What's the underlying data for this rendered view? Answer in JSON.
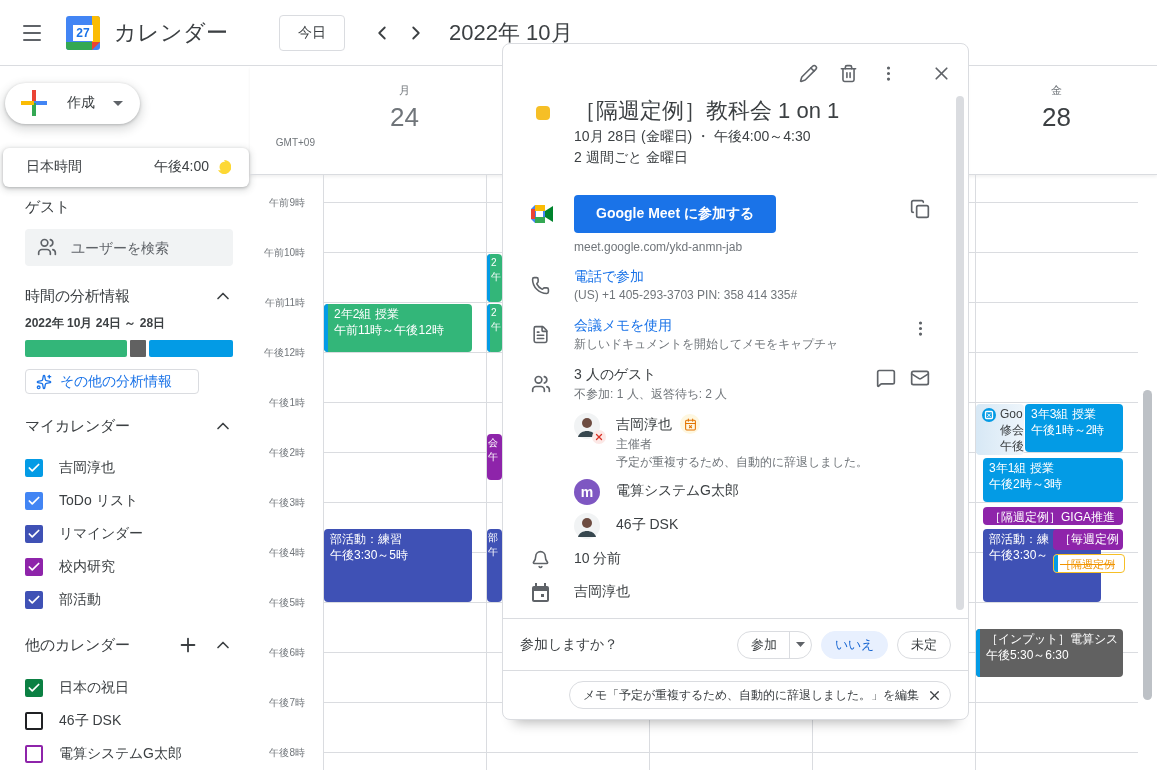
{
  "header": {
    "logo_text": "27",
    "app_name": "カレンダー",
    "today_button": "今日",
    "period": "2022年 10月"
  },
  "create_button": "作成",
  "timezone": {
    "label": "日本時間",
    "time": "午後4:00"
  },
  "guests_section": {
    "title": "ゲスト",
    "search_placeholder": "ユーザーを検索"
  },
  "time_insights": {
    "title": "時間の分析情報",
    "expanded": true,
    "range": "2022年 10月 24日 ～ 28日",
    "more_button": "その他の分析情報"
  },
  "my_calendars": {
    "title": "マイカレンダー",
    "expanded": true,
    "items": [
      {
        "name": "吉岡淳也",
        "checked": true,
        "color": "#039be5"
      },
      {
        "name": "ToDo リスト",
        "checked": true,
        "color": "#4285f4"
      },
      {
        "name": "リマインダー",
        "checked": true,
        "color": "#3f51b5"
      },
      {
        "name": "校内研究",
        "checked": true,
        "color": "#8e24aa"
      },
      {
        "name": "部活動",
        "checked": true,
        "color": "#3f51b5"
      }
    ]
  },
  "other_calendars": {
    "title": "他のカレンダー",
    "expanded": true,
    "items": [
      {
        "name": "日本の祝日",
        "checked": true,
        "color": "#0b8043"
      },
      {
        "name": "46子 DSK",
        "checked": false,
        "color": "#202124"
      },
      {
        "name": "電算システムG太郎",
        "checked": false,
        "color": "#8e24aa"
      }
    ]
  },
  "week": {
    "timezone_label": "GMT+09",
    "hours": [
      "午前9時",
      "午前10時",
      "午前11時",
      "午後12時",
      "午後1時",
      "午後2時",
      "午後3時",
      "午後4時",
      "午後5時",
      "午後6時",
      "午後7時",
      "午後8時"
    ],
    "day_columns": [
      {
        "weekday": "月",
        "date": "24",
        "events": [
          {
            "kind": "solid",
            "lines": [
              "2年2組 授業",
              "午前11時～午後12時"
            ],
            "color": "#33b679",
            "stripe": {
              "color": "#039be5"
            }
          },
          {
            "kind": "solid",
            "lines": [
              "部活動：練習",
              "午後3:30～5時"
            ],
            "color": "#3f51b5"
          }
        ]
      },
      {
        "events": [
          {
            "kind": "solid",
            "lines": [
              "2",
              "午"
            ],
            "color": "#33b679",
            "stripe": {
              "color": "#039be5"
            }
          },
          {
            "kind": "solid",
            "lines": [
              "2",
              "午"
            ],
            "color": "#33b679",
            "stripe": {
              "color": "#039be5"
            }
          },
          {
            "kind": "solid",
            "lines": [
              "会",
              "午"
            ],
            "color": "#8e24aa"
          },
          {
            "kind": "solid",
            "lines": [
              "部",
              "午"
            ],
            "color": "#3f51b5"
          }
        ]
      },
      {},
      {},
      {
        "weekday": "金",
        "date": "28",
        "events": [
          {
            "kind": "outlined",
            "lines": [
              "Goo",
              "修会",
              "午後"
            ],
            "color": "#d7e8f5"
          },
          {
            "kind": "solid",
            "lines": [
              "3年3組 授業",
              "午後1時～2時"
            ],
            "color": "#039be5"
          },
          {
            "kind": "solid",
            "lines": [
              "3年1組 授業",
              "午後2時～3時"
            ],
            "color": "#039be5"
          },
          {
            "kind": "solid",
            "lines": [
              "［隔週定例］GIGA推進"
            ],
            "color": "#8e24aa"
          },
          {
            "kind": "solid",
            "lines": [
              "部活動：練",
              "午後3:30～"
            ],
            "color": "#3f51b5"
          },
          {
            "kind": "solid",
            "lines": [
              "［毎週定例"
            ],
            "color": "#8e24aa"
          },
          {
            "kind": "declined",
            "lines": [
              "［隔週定例"
            ],
            "color": "#f6bf26",
            "stripe": {
              "color": "#039be5"
            }
          },
          {
            "kind": "solid",
            "lines": [
              "［インプット］電算シス",
              "午後5:30～6:30"
            ],
            "color": "#616161",
            "stripe": {
              "color": "#039be5"
            }
          }
        ]
      }
    ]
  },
  "event_popup": {
    "color": "#f6bf26",
    "title": "［隔週定例］教科会 1 on 1",
    "when": "10月 28日 (金曜日) ・ 午後4:00～4:30",
    "recurrence": "2 週間ごと 金曜日",
    "meet_button": "Google Meet に参加する",
    "meet_link": "meet.google.com/ykd-anmn-jab",
    "phone_link": "電話で参加",
    "phone_detail": "(US) +1 405-293-3703 PIN: 358 414 335#",
    "notes_link": "会議メモを使用",
    "notes_detail": "新しいドキュメントを開始してメモをキャプチャ",
    "guests_title": "3 人のゲスト",
    "guests_summary": "不参加: 1 人、返答待ち: 2 人",
    "guests": [
      {
        "name": "吉岡淳也",
        "kind": "photo",
        "declined": true,
        "organizer": true,
        "role": "主催者",
        "note": "予定が重複するため、自動的に辞退しました。"
      },
      {
        "name": "電算システムG太郎",
        "kind": "letter",
        "letter": "m",
        "declined": false,
        "organizer": false
      },
      {
        "name": "46子 DSK",
        "kind": "photo",
        "declined": false,
        "organizer": false
      }
    ],
    "reminder": "10 分前",
    "calendar": "吉岡淳也",
    "rsvp_question": "参加しますか？",
    "rsvp": [
      {
        "label": "参加",
        "kind": "split",
        "selected": false
      },
      {
        "label": "いいえ",
        "kind": "plain",
        "selected": true
      },
      {
        "label": "未定",
        "kind": "plain",
        "selected": false
      }
    ],
    "memo_chip": "メモ「予定が重複するため、自動的に辞退しました。」を編集"
  }
}
